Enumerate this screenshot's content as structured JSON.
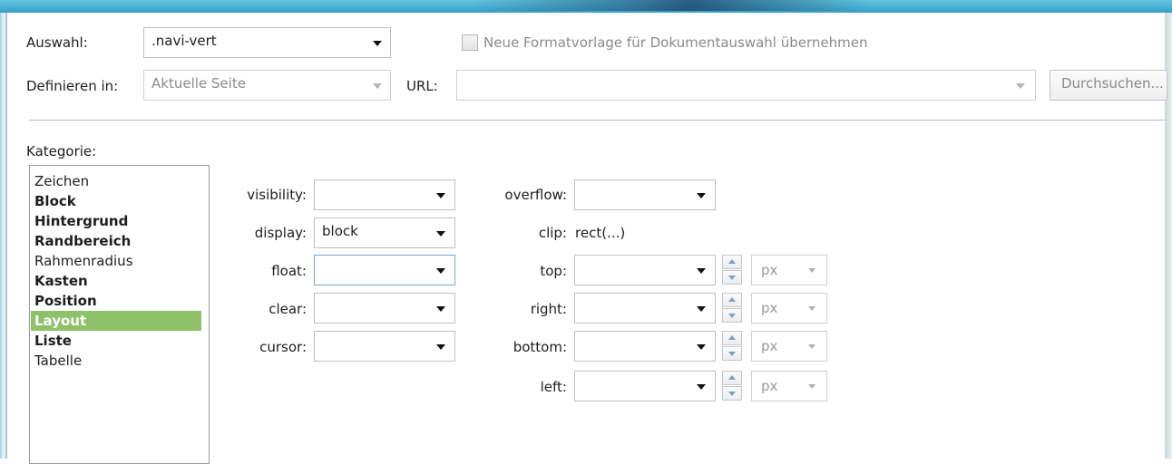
{
  "header": {
    "selection_label": "Auswahl:",
    "selection_value": ".navi-vert",
    "new_template_checkbox_label": "Neue Formatvorlage für Dokumentauswahl übernehmen",
    "define_in_label": "Definieren in:",
    "define_in_value": "Aktuelle Seite",
    "url_label": "URL:",
    "url_value": "",
    "browse_button": "Durchsuchen..."
  },
  "category": {
    "label": "Kategorie:",
    "items": [
      {
        "label": "Zeichen",
        "bold": false,
        "selected": false
      },
      {
        "label": "Block",
        "bold": true,
        "selected": false
      },
      {
        "label": "Hintergrund",
        "bold": true,
        "selected": false
      },
      {
        "label": "Randbereich",
        "bold": true,
        "selected": false
      },
      {
        "label": "Rahmenradius",
        "bold": false,
        "selected": false
      },
      {
        "label": "Kasten",
        "bold": true,
        "selected": false
      },
      {
        "label": "Position",
        "bold": true,
        "selected": false
      },
      {
        "label": "Layout",
        "bold": true,
        "selected": true
      },
      {
        "label": "Liste",
        "bold": true,
        "selected": false
      },
      {
        "label": "Tabelle",
        "bold": false,
        "selected": false
      }
    ]
  },
  "layout": {
    "visibility": {
      "label": "visibility:",
      "value": ""
    },
    "display": {
      "label": "display:",
      "value": "block"
    },
    "float": {
      "label": "float:",
      "value": ""
    },
    "clear": {
      "label": "clear:",
      "value": ""
    },
    "cursor": {
      "label": "cursor:",
      "value": ""
    },
    "overflow": {
      "label": "overflow:",
      "value": ""
    },
    "clip": {
      "label": "clip:",
      "value": "rect(...)"
    },
    "top": {
      "label": "top:",
      "value": "",
      "unit": "px"
    },
    "right": {
      "label": "right:",
      "value": "",
      "unit": "px"
    },
    "bottom": {
      "label": "bottom:",
      "value": "",
      "unit": "px"
    },
    "left": {
      "label": "left:",
      "value": "",
      "unit": "px"
    }
  },
  "colors": {
    "selected_item": "#8fc06a",
    "title_bar": "#49b2d4"
  }
}
